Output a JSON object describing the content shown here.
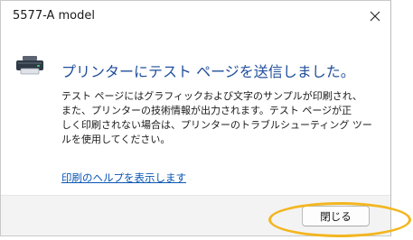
{
  "window": {
    "title": "5577-A model",
    "close_icon": "close-icon"
  },
  "dialog": {
    "icon": "printer-icon",
    "main_instruction": "プリンターにテスト ページを送信しました。",
    "body_lines": [
      "テスト ページにはグラフィックおよび文字のサンプルが印刷され、",
      "また、プリンターの技術情報が出力されます。テスト ページが正",
      "しく印刷されない場合は、プリンターのトラブルシューティング ツー",
      "ルを使用してください。"
    ],
    "help_link": "印刷のヘルプを表示します"
  },
  "footer": {
    "close_button_label": "閉じる"
  },
  "colors": {
    "instruction_text": "#1f4e9a",
    "link": "#0a56b4",
    "footer_bg": "#f3f3f3",
    "highlight_ring": "#f3b61f"
  }
}
